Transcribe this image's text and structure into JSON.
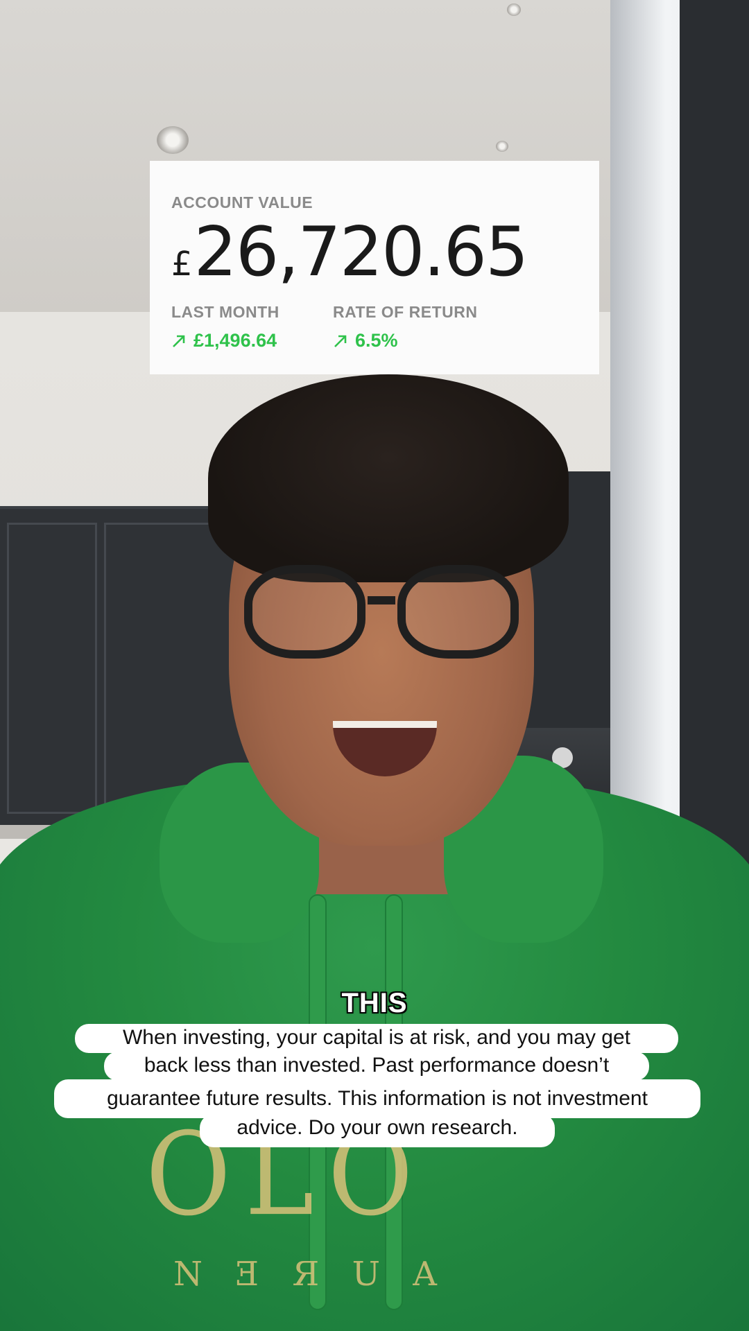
{
  "account_card": {
    "title": "ACCOUNT VALUE",
    "currency_symbol": "£",
    "value": "26,720.65",
    "last_month_label": "LAST MONTH",
    "last_month_value": "£1,496.64",
    "rate_label": "RATE OF RETURN",
    "rate_value": "6.5%",
    "positive_color": "#2fc24b",
    "trend_icon": "arrow-up-right-icon"
  },
  "caption": {
    "highlight_word": "THIS",
    "disclaimer_lines": [
      "When investing, your capital is at risk, and you may get",
      "back less than invested. Past performance doesn’t",
      "guarantee future results. This information is not investment",
      "advice. Do your own research."
    ]
  }
}
